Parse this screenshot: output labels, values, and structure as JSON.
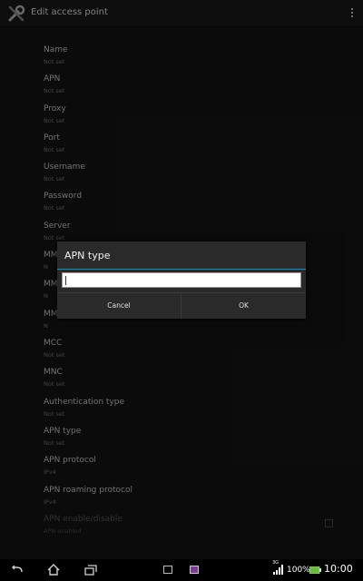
{
  "action_bar": {
    "title": "Edit access point",
    "app_icon": "wrench-screwdriver-icon",
    "overflow_icon": "overflow-menu-icon"
  },
  "preferences": [
    {
      "title": "Name",
      "summary": "Not set"
    },
    {
      "title": "APN",
      "summary": "Not set"
    },
    {
      "title": "Proxy",
      "summary": "Not set"
    },
    {
      "title": "Port",
      "summary": "Not set"
    },
    {
      "title": "Username",
      "summary": "Not set"
    },
    {
      "title": "Password",
      "summary": "Not set"
    },
    {
      "title": "Server",
      "summary": "Not set"
    },
    {
      "title": "MM",
      "summary": "N"
    },
    {
      "title": "MM",
      "summary": "N"
    },
    {
      "title": "MM",
      "summary": "N"
    },
    {
      "title": "MCC",
      "summary": "Not set"
    },
    {
      "title": "MNC",
      "summary": "Not set"
    },
    {
      "title": "Authentication type",
      "summary": "Not set"
    },
    {
      "title": "APN type",
      "summary": "Not set"
    },
    {
      "title": "APN protocol",
      "summary": "IPv4"
    },
    {
      "title": "APN roaming protocol",
      "summary": "IPv4"
    },
    {
      "title": "APN enable/disable",
      "summary": "APN enabled",
      "checked": false
    }
  ],
  "dialog": {
    "title": "APN type",
    "input_value": "",
    "cancel_label": "Cancel",
    "ok_label": "OK",
    "accent_color": "#3a7fa8"
  },
  "status_bar": {
    "network": "3G",
    "battery_percent": "100%",
    "time": "10:00"
  },
  "nav_bar": {
    "icons": [
      "back-icon",
      "home-icon",
      "recent-apps-icon",
      "small-app-icon",
      "small-app-icon",
      "signal-icon",
      "battery-icon"
    ]
  }
}
